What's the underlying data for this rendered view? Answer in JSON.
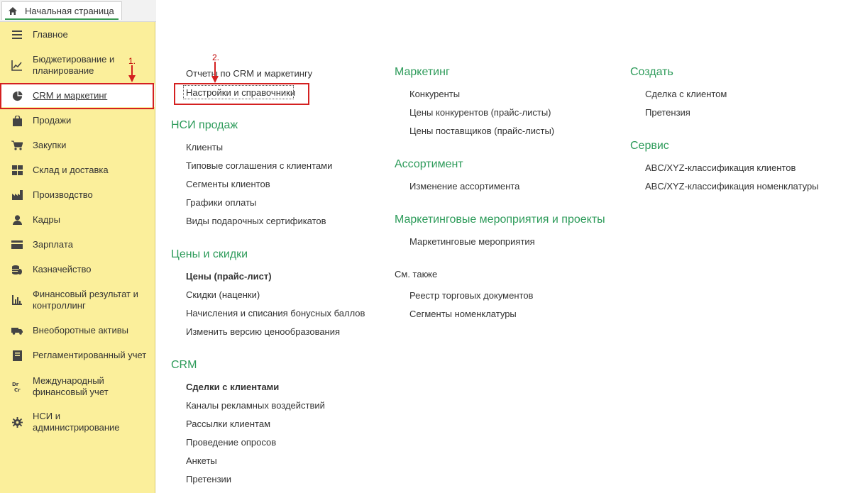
{
  "tab": {
    "label": "Начальная страница",
    "icon": "home-icon"
  },
  "sidebar": {
    "items": [
      {
        "label": "Главное",
        "icon": "menu-lines-icon"
      },
      {
        "label": "Бюджетирование и планирование",
        "icon": "chart-line-icon"
      },
      {
        "label": "CRM и маркетинг",
        "icon": "pie-chart-icon"
      },
      {
        "label": "Продажи",
        "icon": "shopping-bag-icon"
      },
      {
        "label": "Закупки",
        "icon": "shopping-cart-icon"
      },
      {
        "label": "Склад и доставка",
        "icon": "grid-blocks-icon"
      },
      {
        "label": "Производство",
        "icon": "factory-icon"
      },
      {
        "label": "Кадры",
        "icon": "person-icon"
      },
      {
        "label": "Зарплата",
        "icon": "wallet-icon"
      },
      {
        "label": "Казначейство",
        "icon": "coins-icon"
      },
      {
        "label": "Финансовый результат и контроллинг",
        "icon": "bar-chart-icon"
      },
      {
        "label": "Внеоборотные активы",
        "icon": "truck-icon"
      },
      {
        "label": "Регламентированный учет",
        "icon": "ledger-icon"
      },
      {
        "label": "Международный финансовый учет",
        "icon": "dr-cr-icon"
      },
      {
        "label": "НСИ и администрирование",
        "icon": "gear-icon"
      }
    ]
  },
  "annotations": {
    "step1": "1.",
    "step2": "2."
  },
  "main": {
    "col1": {
      "top_links": [
        "Отчеты по CRM и маркетингу",
        "Настройки и справочники"
      ],
      "nsi": {
        "title": "НСИ продаж",
        "links": [
          "Клиенты",
          "Типовые соглашения с клиентами",
          "Сегменты клиентов",
          "Графики оплаты",
          "Виды подарочных сертификатов"
        ]
      },
      "prices": {
        "title": "Цены и скидки",
        "links": [
          "Цены (прайс-лист)",
          "Скидки (наценки)",
          "Начисления и списания бонусных баллов",
          "Изменить версию ценообразования"
        ]
      },
      "crm": {
        "title": "CRM",
        "links": [
          "Сделки с клиентами",
          "Каналы рекламных воздействий",
          "Рассылки клиентам",
          "Проведение опросов",
          "Анкеты",
          "Претензии"
        ]
      }
    },
    "col2": {
      "marketing": {
        "title": "Маркетинг",
        "links": [
          "Конкуренты",
          "Цены конкурентов (прайс-листы)",
          "Цены поставщиков (прайс-листы)"
        ]
      },
      "assortment": {
        "title": "Ассортимент",
        "links": [
          "Изменение ассортимента"
        ]
      },
      "events": {
        "title": "Маркетинговые мероприятия и проекты",
        "links": [
          "Маркетинговые мероприятия"
        ]
      },
      "see_also": {
        "title": "См. также",
        "links": [
          "Реестр торговых документов",
          "Сегменты номенклатуры"
        ]
      }
    },
    "col3": {
      "create": {
        "title": "Создать",
        "links": [
          "Сделка с клиентом",
          "Претензия"
        ]
      },
      "service": {
        "title": "Сервис",
        "links": [
          "ABC/XYZ-классификация клиентов",
          "ABC/XYZ-классификация номенклатуры"
        ]
      }
    }
  },
  "colors": {
    "sidebar_bg": "#fbef9b",
    "section_green": "#2d9b5a",
    "highlight_red": "#d42020"
  }
}
